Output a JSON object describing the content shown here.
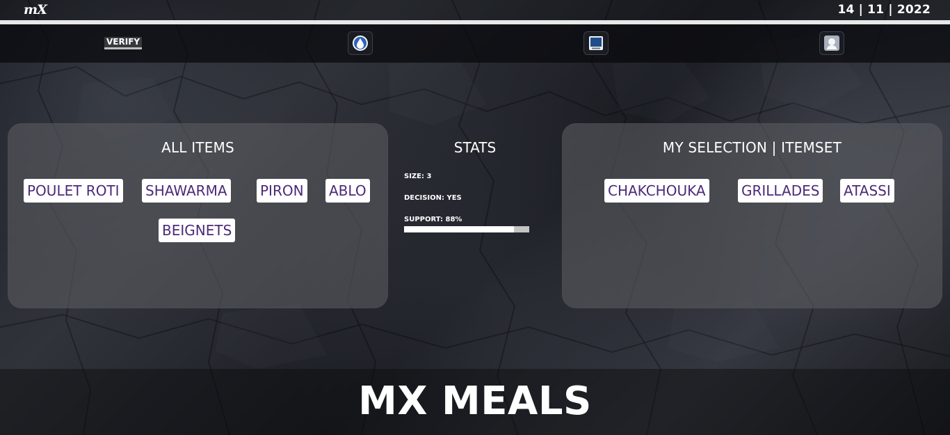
{
  "header": {
    "logo": "mX",
    "date": "14 | 11 | 2022"
  },
  "nav": {
    "verify_label": "VERIFY",
    "icons": [
      "water-drop-icon",
      "monitor-icon",
      "user-profile-icon"
    ]
  },
  "all_items": {
    "title": "ALL ITEMS",
    "items": [
      "POULET ROTI",
      "SHAWARMA",
      "PIRON",
      "ABLO",
      "BEIGNETS"
    ]
  },
  "stats": {
    "title": "STATS",
    "size": "SIZE: 3",
    "decision": "DECISION: YES",
    "support": "SUPPORT: 88%",
    "support_percent": 88
  },
  "selection": {
    "title": "MY SELECTION | ITEMSET",
    "items": [
      "CHAKCHOUKA",
      "GRILLADES",
      "ATASSI"
    ]
  },
  "footer": {
    "title": "MX MEALS"
  },
  "colors": {
    "chip_text": "#4b2a78",
    "chip_bg": "#ffffff",
    "panel": "#585a60"
  }
}
